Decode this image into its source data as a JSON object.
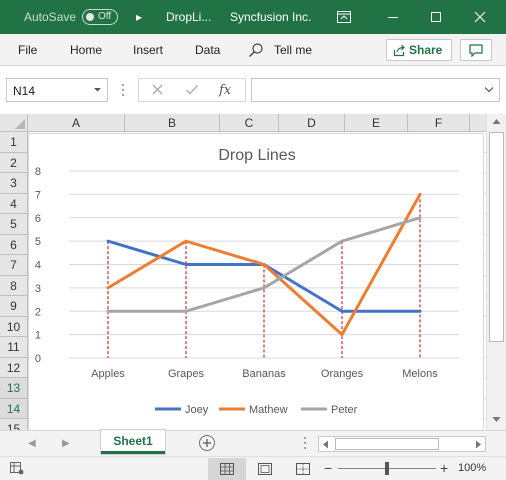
{
  "titlebar": {
    "autosave_label": "AutoSave",
    "autosave_state": "Off",
    "more_glyph": "▸",
    "doc_title": "DropLi...",
    "company": "Syncfusion Inc."
  },
  "menu": {
    "file": "File",
    "home": "Home",
    "insert": "Insert",
    "data": "Data",
    "tell_me": "Tell me",
    "share": "Share"
  },
  "formula_bar": {
    "name_box": "N14",
    "fx_label": "fx",
    "formula": ""
  },
  "sheet": {
    "columns": [
      "A",
      "B",
      "C",
      "D",
      "E",
      "F"
    ],
    "rows": [
      "1",
      "2",
      "3",
      "4",
      "5",
      "6",
      "7",
      "8",
      "9",
      "10",
      "11",
      "12",
      "13",
      "14",
      "15"
    ],
    "selected_rows": [
      "13",
      "14"
    ]
  },
  "tabs": {
    "active_sheet": "Sheet1"
  },
  "status": {
    "zoom": "100%"
  },
  "colors": {
    "excel_green": "#217346",
    "joey": "#4472C4",
    "mathew": "#ED7D31",
    "peter": "#A5A5A5",
    "drop_line": "#C00000"
  },
  "chart_data": {
    "type": "line",
    "title": "Drop Lines",
    "categories": [
      "Apples",
      "Grapes",
      "Bananas",
      "Oranges",
      "Melons"
    ],
    "series": [
      {
        "name": "Joey",
        "values": [
          5,
          4,
          4,
          2,
          2
        ]
      },
      {
        "name": "Mathew",
        "values": [
          3,
          5,
          4,
          1,
          7
        ]
      },
      {
        "name": "Peter",
        "values": [
          2,
          2,
          3,
          5,
          6
        ]
      }
    ],
    "ylim": [
      0,
      8
    ],
    "yticks": [
      "0",
      "1",
      "2",
      "3",
      "4",
      "5",
      "6",
      "7",
      "8"
    ],
    "grid": true,
    "drop_lines": true,
    "legend_position": "bottom"
  }
}
